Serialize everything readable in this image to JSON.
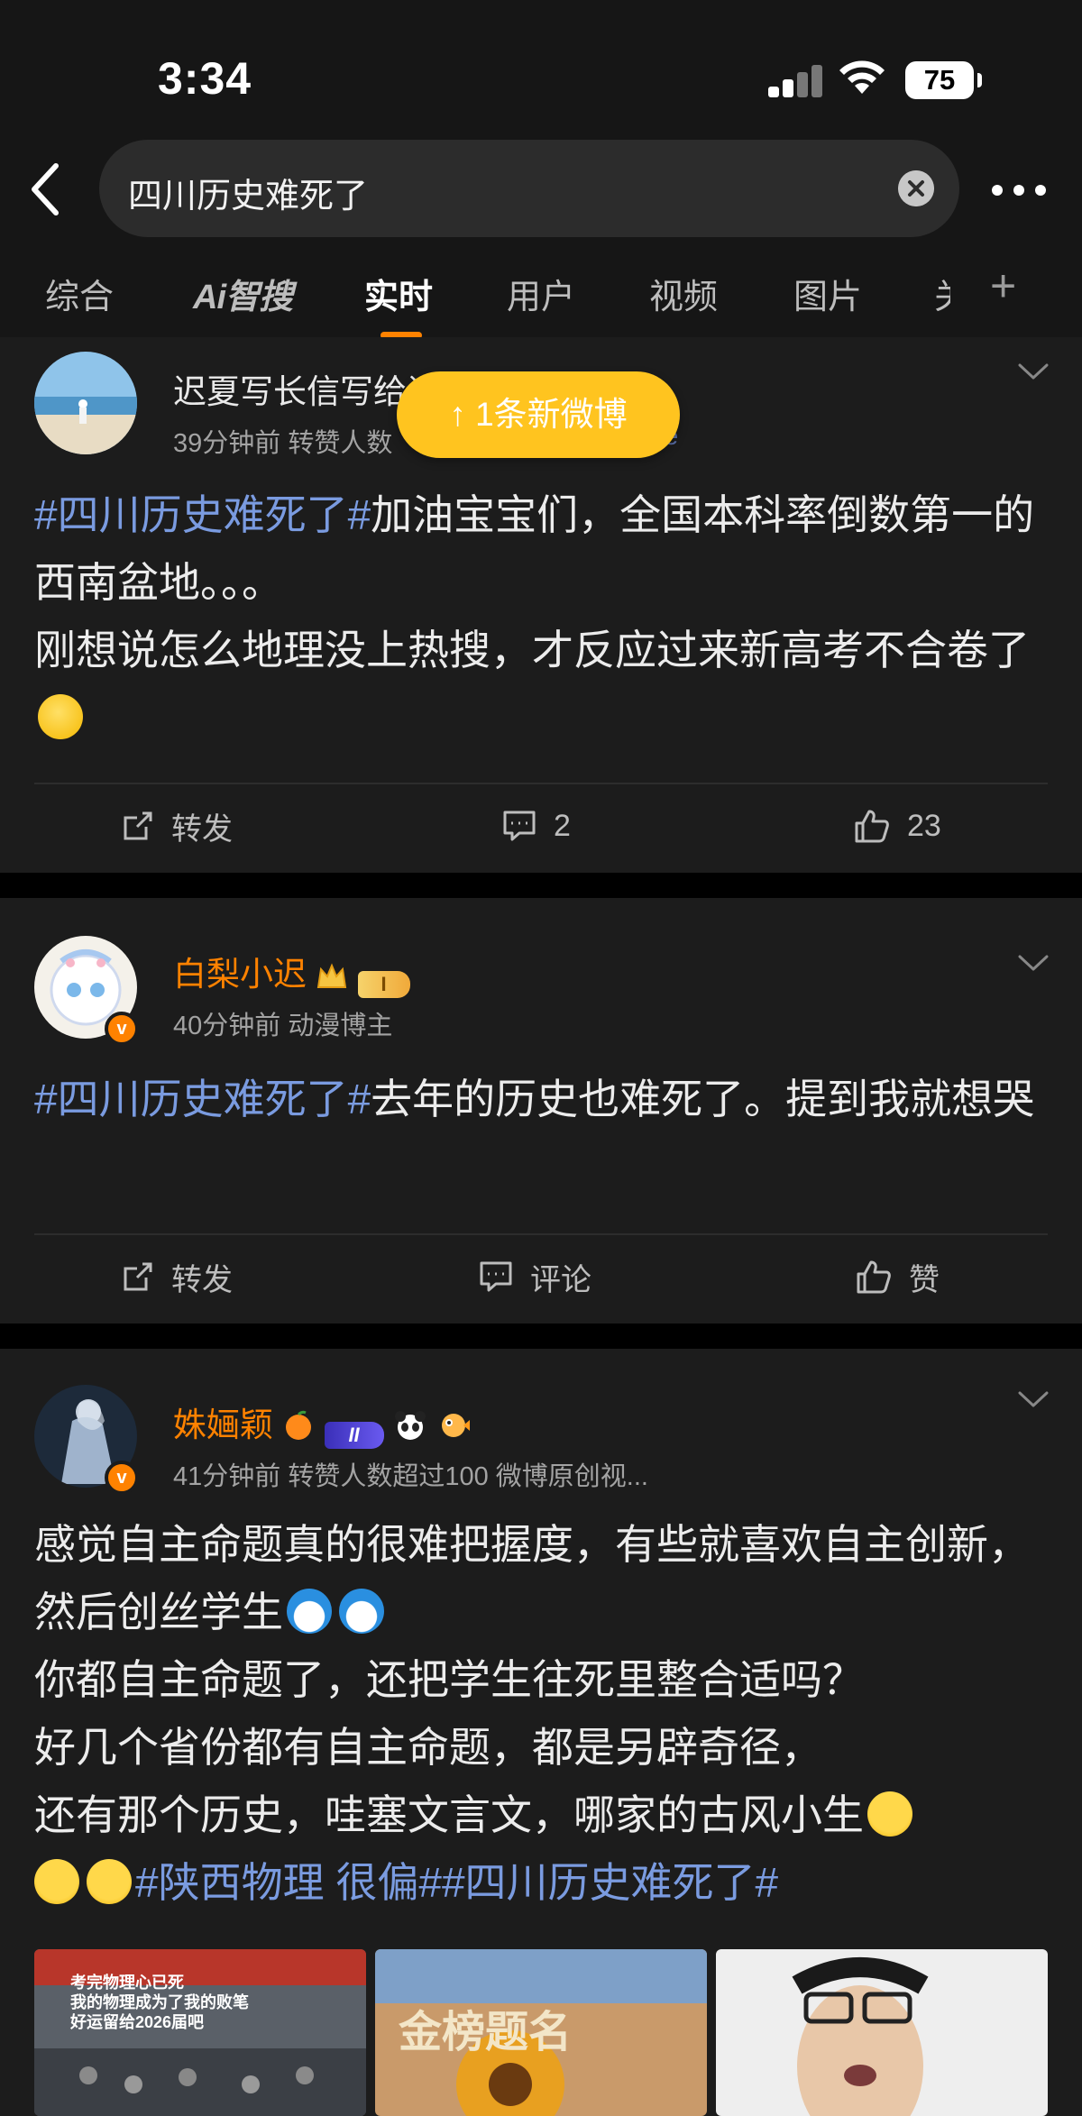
{
  "status_bar": {
    "time": "3:34",
    "battery": "75"
  },
  "search": {
    "query": "四川历史难死了"
  },
  "tabs": [
    {
      "label": "综合"
    },
    {
      "label": "Ai智搜"
    },
    {
      "label": "实时"
    },
    {
      "label": "用户"
    },
    {
      "label": "视频"
    },
    {
      "label": "图片"
    },
    {
      "label": "关"
    }
  ],
  "active_tab": "实时",
  "new_posts_pill": "↑ 1条新微博",
  "posts": [
    {
      "username": "迟夏写长信写给谁",
      "meta": "39分钟前  转赞人数",
      "meta_tail": "ne",
      "topic": "#四川历史难死了#",
      "text_1": "加油宝宝们，全国本科率倒数第一的西南盆地。。。",
      "text_2": "刚想说怎么地理没上热搜，才反应过来新高考不合卷了",
      "repost_label": "转发",
      "comment_label": "2",
      "like_label": "23"
    },
    {
      "username": "白梨小迟",
      "level_badge": "I",
      "meta": "40分钟前  动漫博主",
      "topic": "#四川历史难死了#",
      "text_1": "去年的历史也难死了。提到我就想哭",
      "repost_label": "转发",
      "comment_label": "评论",
      "like_label": "赞"
    },
    {
      "username": "姝婳颖",
      "level_badge": "II",
      "meta": "41分钟前  转赞人数超过100  微博原创视...",
      "text_1": "感觉自主命题真的很难把握度，有些就喜欢自主创新，然后创丝学生",
      "text_2": "你都自主命题了，还把学生往死里整合适吗？",
      "text_3": "好几个省份都有自主命题，都是另辟奇径，",
      "text_4": "还有那个历史，哇塞文言文，哪家的古风小生",
      "topic_1": "#陕西物理 很偏#",
      "topic_2": "#四川历史难死了#",
      "thumb_1_caption_1": "考完物理心已死",
      "thumb_1_caption_2": "我的物理成为了我的败笔",
      "thumb_1_caption_3": "好运留给2026届吧",
      "thumb_2_caption": "金榜题名"
    }
  ],
  "colors": {
    "accent": "#ff8200",
    "topic": "#7a9be0",
    "pill": "#ffc41f",
    "vip_name": "#ff8200"
  }
}
